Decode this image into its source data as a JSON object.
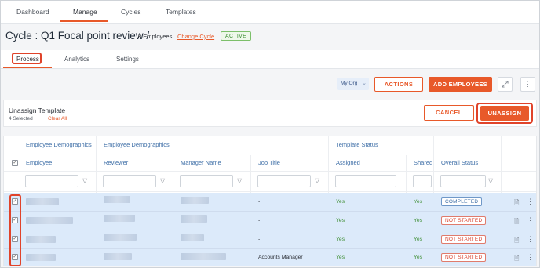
{
  "top_nav": {
    "tabs": [
      {
        "label": "Dashboard"
      },
      {
        "label": "Manage"
      },
      {
        "label": "Cycles"
      },
      {
        "label": "Templates"
      }
    ],
    "active": "Manage"
  },
  "cycle": {
    "title": "Cycle : Q1 Focal point review /",
    "employee_count": "8 Employees",
    "change_link": "Change Cycle",
    "status": "ACTIVE"
  },
  "sub_tabs": {
    "tabs": [
      {
        "label": "Process"
      },
      {
        "label": "Analytics"
      },
      {
        "label": "Settings"
      }
    ],
    "active": "Process"
  },
  "toolbar": {
    "org_filter": "My Org",
    "actions_label": "ACTIONS",
    "add_employees_label": "ADD EMPLOYEES",
    "expand_icon": "expand-icon",
    "more_icon": "vertical-dots-icon"
  },
  "unassign_panel": {
    "title": "Unassign Template",
    "selected_text": "4 Selected",
    "clear_all": "Clear All",
    "cancel_label": "CANCEL",
    "unassign_label": "UNASSIGN"
  },
  "table": {
    "group_headers": {
      "employee_demographics_1": "Employee Demographics",
      "employee_demographics_2": "Employee Demographics",
      "template_status": "Template Status"
    },
    "columns": {
      "employee": "Employee",
      "reviewer": "Reviewer",
      "manager_name": "Manager Name",
      "job_title": "Job Title",
      "assigned": "Assigned",
      "shared": "Shared",
      "overall_status": "Overall Status"
    },
    "rows": [
      {
        "selected": true,
        "job_title": "-",
        "assigned": "Yes",
        "shared": "Yes",
        "overall_status": "COMPLETED"
      },
      {
        "selected": true,
        "job_title": "-",
        "assigned": "Yes",
        "shared": "Yes",
        "overall_status": "NOT STARTED"
      },
      {
        "selected": true,
        "job_title": "-",
        "assigned": "Yes",
        "shared": "Yes",
        "overall_status": "NOT STARTED"
      },
      {
        "selected": true,
        "job_title": "Accounts Manager",
        "assigned": "Yes",
        "shared": "Yes",
        "overall_status": "NOT STARTED"
      }
    ]
  },
  "colors": {
    "accent": "#e8592a",
    "link_blue": "#3c6da6",
    "row_selected": "#dceafa",
    "success_green": "#3f8f35",
    "danger_red": "#d9432f",
    "highlight_outline": "#e0432a"
  }
}
